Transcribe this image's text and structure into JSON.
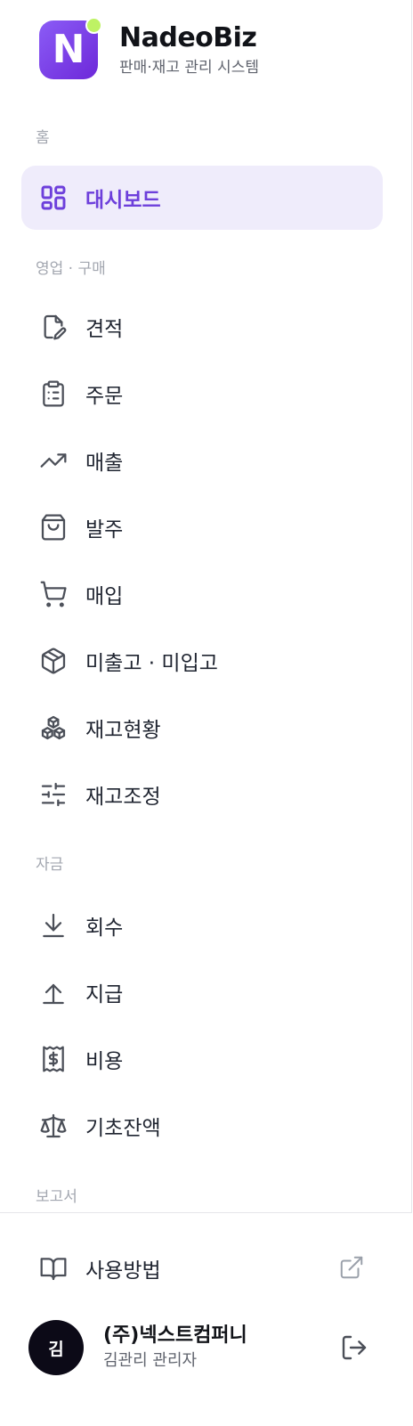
{
  "brand": {
    "logo_letter": "N",
    "name": "NadeoBiz",
    "subtitle": "판매·재고 관리 시스템",
    "logo_color": "#7c3aed",
    "dot_color": "#bef264"
  },
  "sections": {
    "home": "홈",
    "sales_purchase": "영업 · 구매",
    "funds": "자금",
    "reports": "보고서"
  },
  "nav": {
    "dashboard": {
      "label": "대시보드",
      "icon": "dashboard-grid-icon",
      "active": true
    },
    "quote": {
      "label": "견적",
      "icon": "document-edit-icon"
    },
    "order": {
      "label": "주문",
      "icon": "clipboard-list-icon"
    },
    "sales": {
      "label": "매출",
      "icon": "trending-up-icon"
    },
    "purchase_order": {
      "label": "발주",
      "icon": "shopping-bag-icon"
    },
    "purchase": {
      "label": "매입",
      "icon": "shopping-cart-icon"
    },
    "pending": {
      "label": "미출고 · 미입고",
      "icon": "package-icon"
    },
    "inventory_status": {
      "label": "재고현황",
      "icon": "boxes-icon"
    },
    "inventory_adjust": {
      "label": "재고조정",
      "icon": "sliders-icon"
    },
    "collection": {
      "label": "회수",
      "icon": "arrow-down-to-line-icon"
    },
    "payment": {
      "label": "지급",
      "icon": "arrow-up-from-line-icon"
    },
    "expense": {
      "label": "비용",
      "icon": "receipt-dollar-icon"
    },
    "opening_balance": {
      "label": "기초잔액",
      "icon": "scale-icon"
    }
  },
  "footer": {
    "help": {
      "label": "사용방법",
      "icon": "book-open-icon",
      "external_icon": "external-link-icon"
    },
    "user": {
      "avatar_text": "김",
      "company": "(주)넥스트컴퍼니",
      "name_role": "김관리 관리자",
      "logout_icon": "logout-icon"
    }
  },
  "colors": {
    "accent": "#6d3fdb",
    "active_bg": "#efecfb",
    "section_label": "#a3a7b0",
    "avatar_bg": "#0c0a17"
  }
}
